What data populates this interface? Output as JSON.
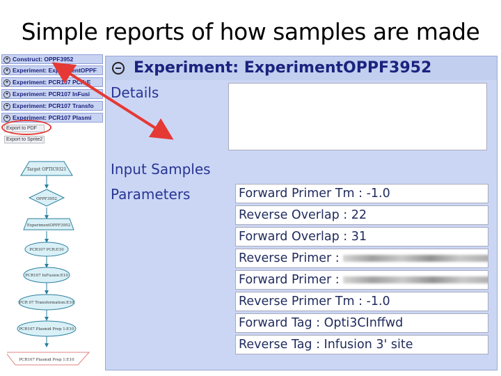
{
  "slide": {
    "title": "Simple reports of how samples are made"
  },
  "tree": {
    "items": [
      {
        "label": "Construct: OPPF3952"
      },
      {
        "label": "Experiment: ExperimentOPPF"
      },
      {
        "label": "Experiment: PCR107 PCR:E"
      },
      {
        "label": "Experiment: PCR107 InFusi"
      },
      {
        "label": "Experiment: PCR107 Transfo"
      },
      {
        "label": "Experiment: PCR107 Plasmi"
      }
    ],
    "expand_symbol": "+",
    "export_pdf": "Export to PDF",
    "export_sprite": "Export to Sprite2"
  },
  "flow": {
    "nodes": [
      "Target OPTIC9321",
      "OPPF3952",
      "ExperimentOPPF3952",
      "PCR107 PCR:E10",
      "PCR107 InFusion:E10",
      "PCR 07 Transformation:E10",
      "PCR107 Plasmid Prep 1:E10",
      "PCR107 Plasmid Prep 1:E10"
    ]
  },
  "main": {
    "title": "Experiment: ExperimentOPPF3952",
    "details_label": "Details",
    "input_samples_label": "Input Samples",
    "parameters_label": "Parameters",
    "parameters": [
      {
        "text": "Forward Primer Tm : -1.0"
      },
      {
        "text": "Reverse Overlap : 22"
      },
      {
        "text": "Forward Overlap : 31"
      },
      {
        "text": "Reverse Primer :"
      },
      {
        "text": "Forward Primer :"
      },
      {
        "text": "Reverse Primer Tm : -1.0"
      },
      {
        "text": "Forward Tag : Opti3CInffwd"
      },
      {
        "text": "Reverse Tag : Infusion 3' site"
      }
    ]
  },
  "colors": {
    "accent": "#e53935",
    "panel": "#cbd6f5",
    "title_text": "#1a237e"
  }
}
